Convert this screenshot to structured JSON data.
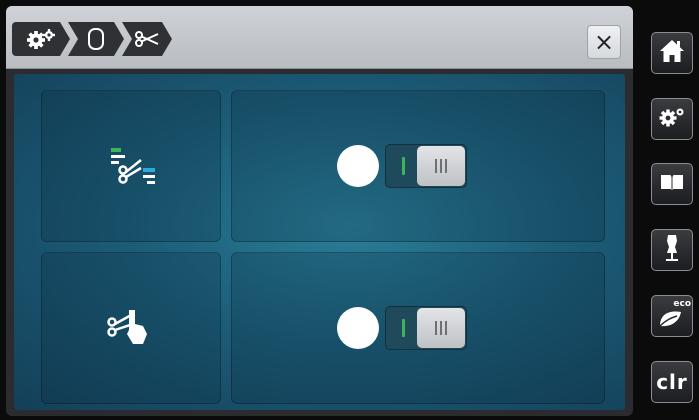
{
  "breadcrumb": {
    "items": [
      {
        "icon": "settings-gears-icon"
      },
      {
        "icon": "presser-foot-icon"
      },
      {
        "icon": "scissors-icon"
      }
    ]
  },
  "header": {
    "close_label": "×"
  },
  "settings": [
    {
      "icon": "thread-cutter-icon",
      "toggle_state": "off"
    },
    {
      "icon": "manual-cut-icon",
      "toggle_state": "off"
    }
  ],
  "sidebar": {
    "items": [
      {
        "icon": "home-icon"
      },
      {
        "icon": "settings-icon"
      },
      {
        "icon": "guide-book-icon"
      },
      {
        "icon": "dress-form-icon"
      },
      {
        "icon": "eco-leaf-icon",
        "badge": "eco"
      },
      {
        "label": "clr"
      }
    ]
  },
  "colors": {
    "header": "#c6c9cd",
    "content": "#1c5d78",
    "toggle_on_mark": "#3fb55a"
  }
}
